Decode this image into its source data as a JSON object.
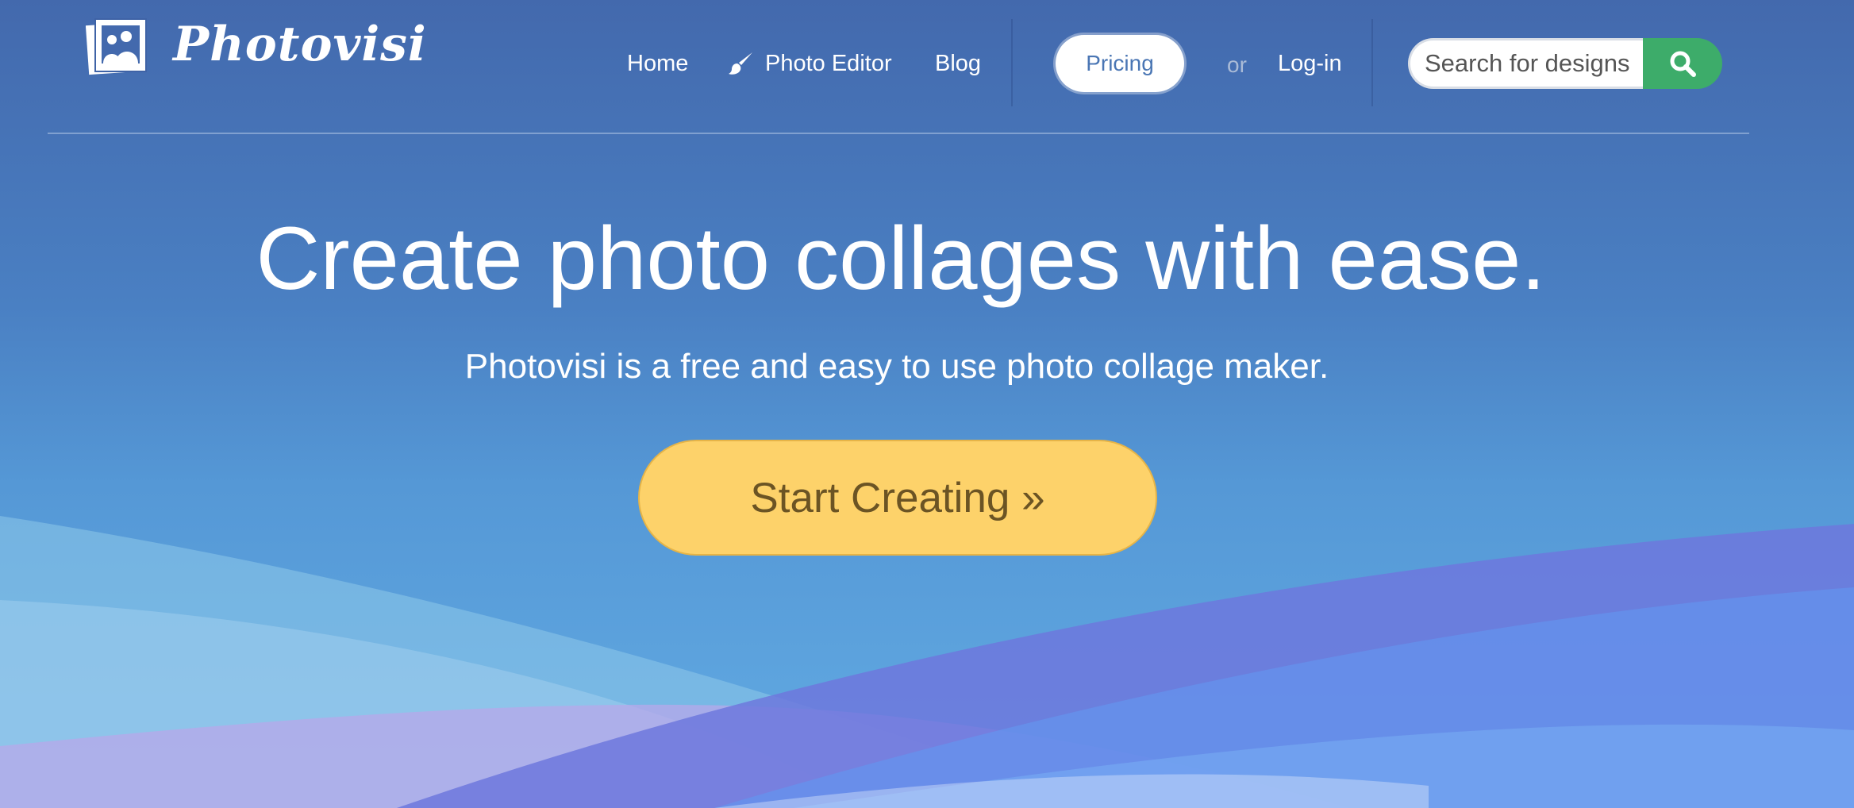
{
  "brand": {
    "name": "Photovisi",
    "logo_icon": "photo-people-icon"
  },
  "nav": {
    "home": "Home",
    "photo_editor": "Photo Editor",
    "photo_editor_icon": "paintbrush-icon",
    "blog": "Blog",
    "pricing": "Pricing",
    "or": "or",
    "login": "Log-in"
  },
  "search": {
    "placeholder": "Search for designs",
    "button_icon": "search-icon"
  },
  "hero": {
    "title": "Create photo collages with ease.",
    "subtitle": "Photovisi is a free and easy to use photo collage maker.",
    "cta_label": "Start Creating »"
  },
  "colors": {
    "background_top": "#4369ad",
    "background_bottom": "#62abe3",
    "cta": "#fdd26a",
    "cta_text": "#6b5424",
    "search_button": "#3dac6a",
    "pricing_text": "#4a76b4"
  }
}
